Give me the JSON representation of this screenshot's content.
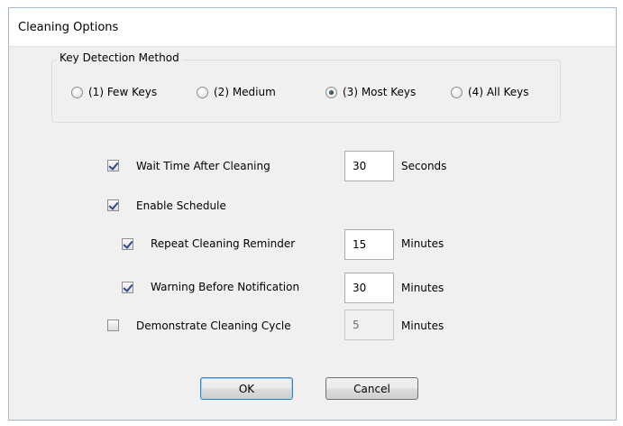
{
  "window": {
    "title": "Cleaning Options"
  },
  "key_detection": {
    "legend": "Key Detection Method",
    "options": [
      {
        "label": "(1) Few Keys",
        "checked": false
      },
      {
        "label": "(2) Medium",
        "checked": false
      },
      {
        "label": "(3) Most Keys",
        "checked": true
      },
      {
        "label": "(4) All Keys",
        "checked": false
      }
    ]
  },
  "settings": {
    "wait_time": {
      "label": "Wait Time After Cleaning",
      "checked": true,
      "value": "30",
      "unit": "Seconds"
    },
    "enable_schedule": {
      "label": "Enable Schedule",
      "checked": true
    },
    "repeat_reminder": {
      "label": "Repeat Cleaning Reminder",
      "checked": true,
      "value": "15",
      "unit": "Minutes"
    },
    "warning_notification": {
      "label": "Warning Before Notification",
      "checked": true,
      "value": "30",
      "unit": "Minutes"
    },
    "demonstrate_cycle": {
      "label": "Demonstrate Cleaning Cycle",
      "checked": false,
      "value": "5",
      "unit": "Minutes",
      "disabled": true
    }
  },
  "buttons": {
    "ok": "OK",
    "cancel": "Cancel"
  }
}
